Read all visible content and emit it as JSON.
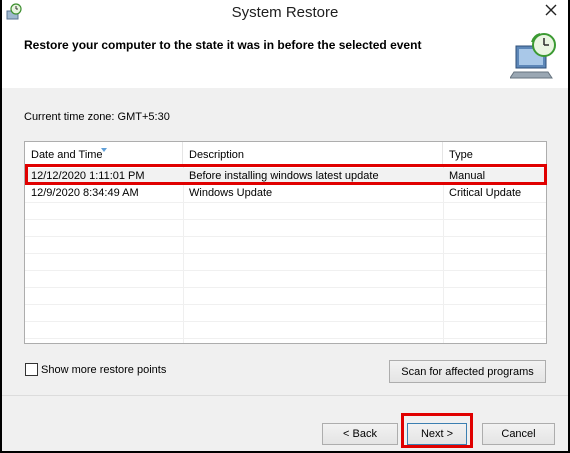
{
  "window": {
    "title": "System Restore"
  },
  "header": {
    "text": "Restore your computer to the state it was in before the selected event"
  },
  "timezone": "Current time zone: GMT+5:30",
  "list": {
    "columns": [
      "Date and Time",
      "Description",
      "Type"
    ],
    "rows": [
      [
        "12/12/2020 1:11:01 PM",
        "Before installing windows latest update",
        "Manual"
      ],
      [
        "12/9/2020 8:34:49 AM",
        "Windows Update",
        "Critical Update"
      ]
    ],
    "selected_index": 0
  },
  "show_more": {
    "label": "Show more restore points",
    "checked": false
  },
  "buttons": {
    "scan": "Scan for affected programs",
    "back": "< Back",
    "next": "Next >",
    "cancel": "Cancel"
  },
  "colors": {
    "highlight": "#e00000",
    "window_bg": "#f0f0f0"
  },
  "icons": {
    "title": "system-restore-icon",
    "header": "system-restore-clock-icon",
    "close": "close-icon"
  }
}
